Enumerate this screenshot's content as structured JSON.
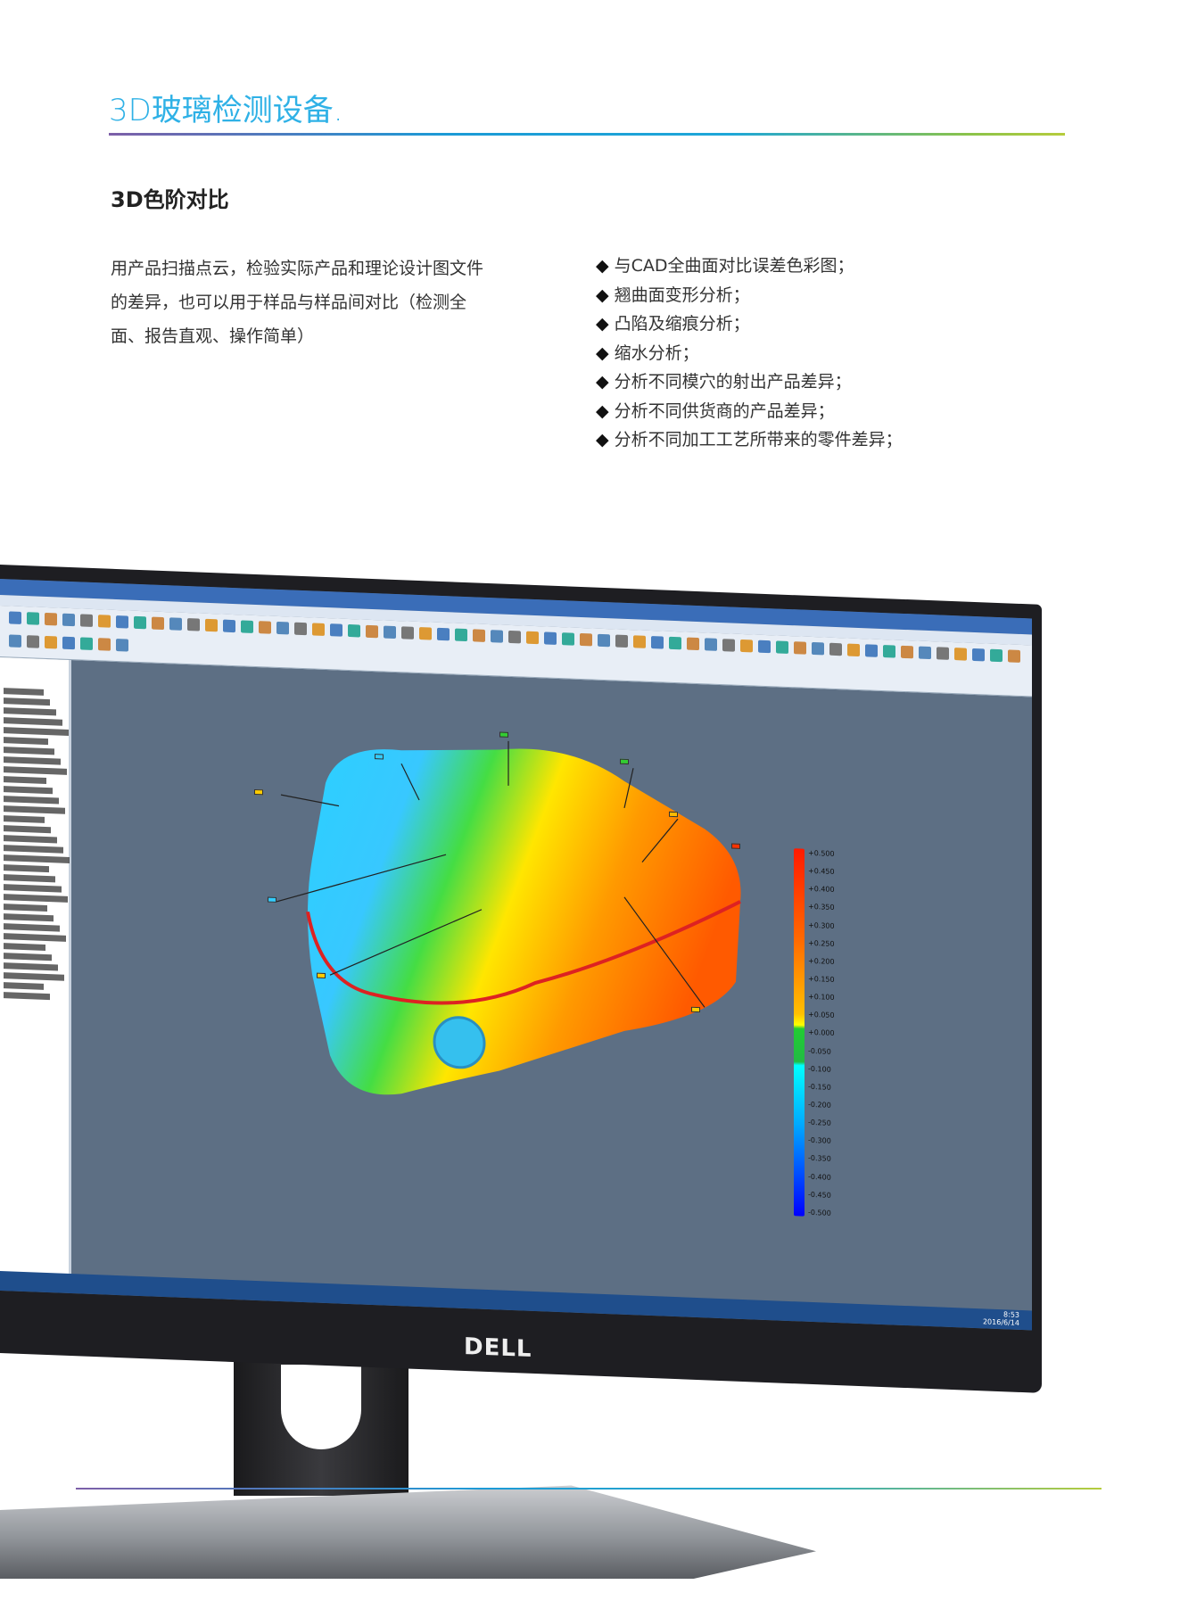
{
  "header": {
    "title": "3D玻璃检测设备."
  },
  "section": {
    "heading": "3D色阶对比",
    "description": "用产品扫描点云，检验实际产品和理论设计图文件的差异，也可以用于样品与样品间对比（检测全面、报告直观、操作简单）",
    "features": [
      "与CAD全曲面对比误差色彩图；",
      "翘曲面变形分析；",
      "凸陷及缩痕分析；",
      "缩水分析；",
      "分析不同模穴的射出产品差异；",
      "分析不同供货商的产品差异；",
      "分析不同加工工艺所带来的零件差异；"
    ]
  },
  "monitor": {
    "brand": "DELL",
    "colorbar_labels": [
      "+0.500",
      "+0.450",
      "+0.400",
      "+0.350",
      "+0.300",
      "+0.250",
      "+0.200",
      "+0.150",
      "+0.100",
      "+0.050",
      "+0.000",
      "-0.050",
      "-0.100",
      "-0.150",
      "-0.200",
      "-0.250",
      "-0.300",
      "-0.350",
      "-0.400",
      "-0.450",
      "-0.500"
    ],
    "clock": {
      "time": "8:53",
      "date": "2016/6/14"
    },
    "colors": {
      "max": "#ff1a00",
      "mid": "#ffff00",
      "zero": "#22cc33",
      "min": "#0000ff",
      "background": "#5d6f84"
    }
  },
  "colors": {
    "title": "#2fb1e6",
    "text": "#333333"
  }
}
